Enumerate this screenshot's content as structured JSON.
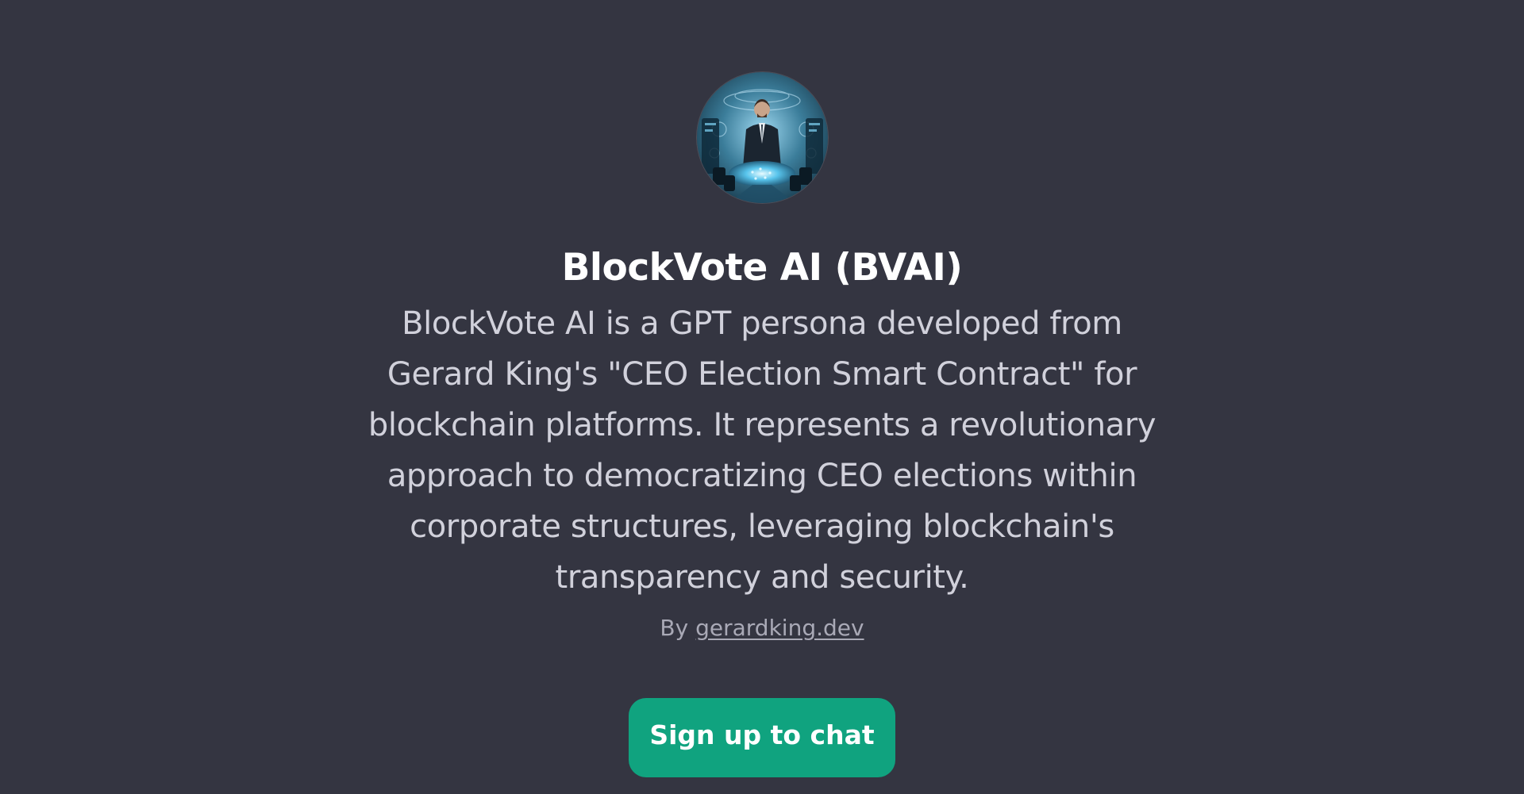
{
  "gpt": {
    "title": "BlockVote AI (BVAI)",
    "description": "BlockVote AI is a GPT persona developed from Gerard King's \"CEO Election Smart Contract\" for blockchain platforms. It represents a revolutionary approach to democratizing CEO elections within corporate structures, leveraging blockchain's transparency and security.",
    "author_prefix": "By",
    "author_link": "gerardking.dev",
    "avatar_icon": "gpt-avatar-image"
  },
  "cta": {
    "label": "Sign up to chat"
  },
  "colors": {
    "background": "#343541",
    "title": "#ffffff",
    "description": "#d1d1db",
    "author": "#a9a9b6",
    "button": "#10a37f"
  }
}
